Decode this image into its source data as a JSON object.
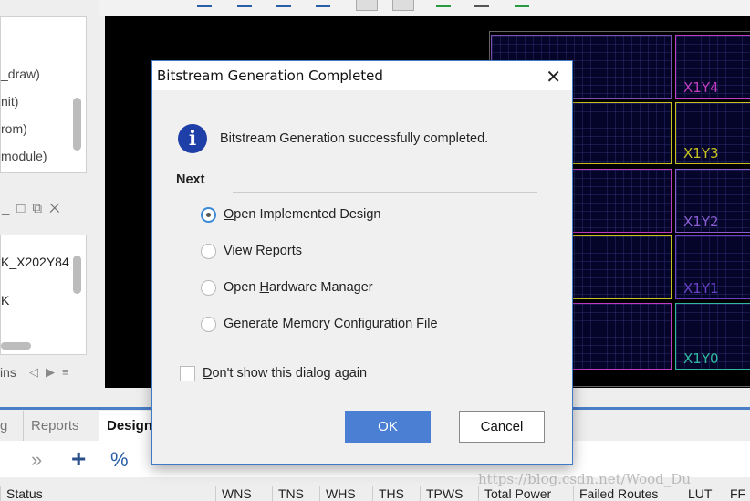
{
  "left_panel": {
    "items": [
      "_draw)",
      "nit)",
      "rom)",
      "module)"
    ],
    "items2": [
      "K_X202Y84",
      "K"
    ],
    "footer": "ins"
  },
  "canvas": {
    "regions": [
      {
        "label": "X1Y4",
        "color": "#c03cc0"
      },
      {
        "label": "X1Y3",
        "color": "#c8c020"
      },
      {
        "label": "X1Y2",
        "color": "#8a5cd0"
      },
      {
        "label": "X1Y1",
        "color": "#6a40c8"
      },
      {
        "label": "X1Y0",
        "color": "#30b8a0"
      }
    ],
    "left_colors": [
      "#7a50b0",
      "#c8c020",
      "#c03cc0",
      "#c8c020",
      "#c03cc0"
    ]
  },
  "dialog": {
    "title": "Bitstream Generation Completed",
    "message": "Bitstream Generation successfully completed.",
    "section": "Next",
    "options": [
      {
        "pre": "",
        "key": "O",
        "post": "pen Implemented Design",
        "selected": true
      },
      {
        "pre": "",
        "key": "V",
        "post": "iew Reports",
        "selected": false
      },
      {
        "pre": "Open ",
        "key": "H",
        "post": "ardware Manager",
        "selected": false
      },
      {
        "pre": "",
        "key": "G",
        "post": "enerate Memory Configuration File",
        "selected": false
      }
    ],
    "checkbox": {
      "key": "D",
      "post": "on't show this dialog again",
      "checked": false
    },
    "ok": "OK",
    "cancel": "Cancel",
    "accent": "#4a7fd4"
  },
  "bottom": {
    "tabs": [
      "g",
      "Reports",
      "Design"
    ],
    "toolbar": [
      "»",
      "+",
      "%"
    ],
    "columns": [
      "Status",
      "WNS",
      "TNS",
      "WHS",
      "THS",
      "TPWS",
      "Total Power",
      "Failed Routes",
      "LUT",
      "FF"
    ]
  },
  "watermark": "https://blog.csdn.net/Wood_Du"
}
